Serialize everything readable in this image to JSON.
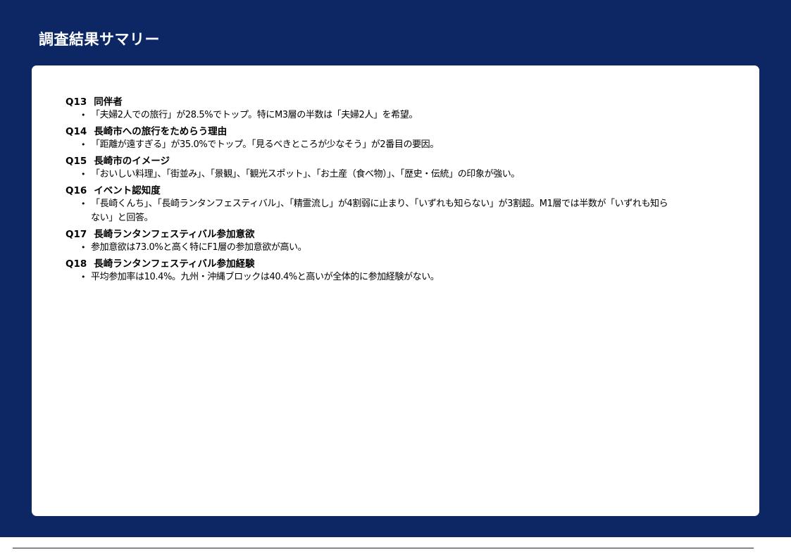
{
  "slide": {
    "title": "調査結果サマリー"
  },
  "sections": [
    {
      "qnum": "Q13",
      "heading": "同伴者",
      "bullets": [
        "「夫婦2人での旅行」が28.5%でトップ。特にM3層の半数は「夫婦2人」を希望。"
      ]
    },
    {
      "qnum": "Q14",
      "heading": "長崎市への旅行をためらう理由",
      "bullets": [
        "「距離が遠すぎる」が35.0%でトップ。「見るべきところが少なそう」が2番目の要因。"
      ]
    },
    {
      "qnum": "Q15",
      "heading": "長崎市のイメージ",
      "bullets": [
        "「おいしい料理」、「街並み」、「景観」、「観光スポット」、「お土産（食べ物）」、「歴史・伝統」の印象が強い。"
      ]
    },
    {
      "qnum": "Q16",
      "heading": "イベント認知度",
      "bullets": [
        "「長崎くんち」、「長崎ランタンフェスティバル」、「精霊流し」が4割弱に止まり、「いずれも知らない」が3割超。M1層では半数が「いずれも知らない」と回答。"
      ]
    },
    {
      "qnum": "Q17",
      "heading": "長崎ランタンフェスティバル参加意欲",
      "bullets": [
        "参加意欲は73.0%と高く特にF1層の参加意欲が高い。"
      ]
    },
    {
      "qnum": "Q18",
      "heading": "長崎ランタンフェスティバル参加経験",
      "bullets": [
        "平均参加率は10.4%。九州・沖縄ブロックは40.4%と高いが全体的に参加経験がない。"
      ]
    }
  ]
}
